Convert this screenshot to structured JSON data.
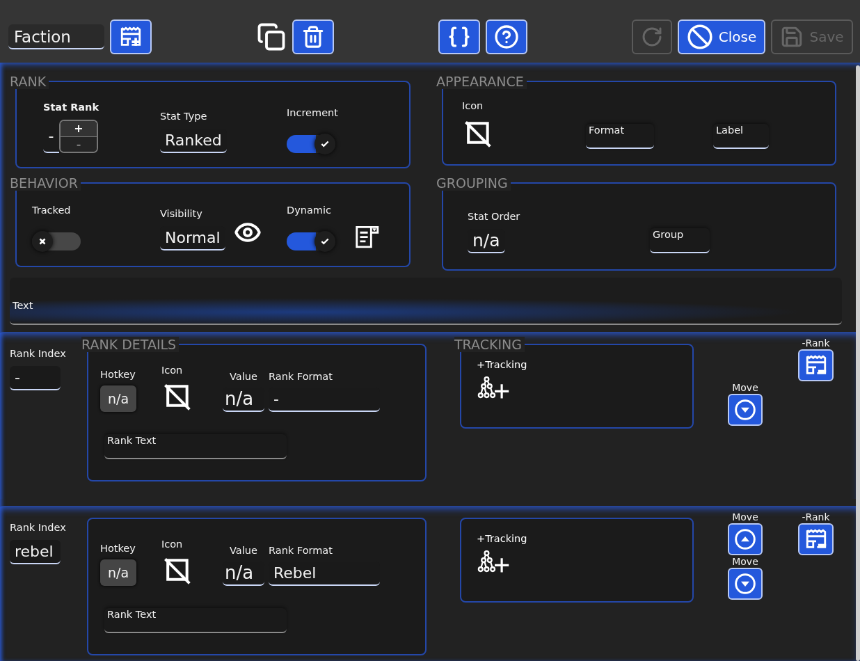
{
  "toolbar": {
    "title_field": {
      "value": "Faction"
    },
    "groups": [
      {
        "buttons": [
          {
            "kind": "add-rank",
            "disabled": false
          }
        ]
      },
      {
        "buttons": [
          {
            "kind": "copy",
            "disabled": false
          },
          {
            "kind": "delete",
            "disabled": false
          }
        ]
      },
      {
        "buttons": [
          {
            "kind": "json",
            "disabled": false
          },
          {
            "kind": "help",
            "disabled": false
          }
        ]
      },
      {
        "buttons": [
          {
            "kind": "reload",
            "disabled": true
          },
          {
            "kind": "close",
            "label": "Close",
            "disabled": false
          },
          {
            "kind": "save",
            "label": "Save",
            "disabled": true
          }
        ]
      }
    ]
  },
  "sections": [
    {
      "kind": "rank",
      "title": "RANK",
      "items": [
        {
          "kind": "stepper",
          "label": "Stat Rank",
          "value": "-",
          "increase": "+",
          "decrease": "-",
          "decrease_disabled": true
        },
        {
          "kind": "field",
          "label": "Stat Type",
          "value": "Ranked"
        },
        {
          "kind": "toggle",
          "label": "Increment",
          "on": true
        }
      ]
    },
    {
      "kind": "appearance",
      "title": "APPEARANCE",
      "items": [
        {
          "kind": "icon-picker",
          "label": "Icon"
        },
        {
          "kind": "floating-field",
          "label": "Format"
        },
        {
          "kind": "floating-field",
          "label": "Label"
        }
      ]
    },
    {
      "kind": "behavior",
      "title": "BEHAVIOR",
      "items": [
        {
          "kind": "toggle",
          "label": "Tracked",
          "on": false
        },
        {
          "kind": "field",
          "label": "Visibility",
          "value": "Normal"
        },
        {
          "kind": "eye-button"
        },
        {
          "kind": "toggle",
          "label": "Dynamic",
          "on": true
        },
        {
          "kind": "list-button"
        }
      ]
    },
    {
      "kind": "grouping",
      "title": "GROUPING",
      "items": [
        {
          "kind": "field",
          "label": "Stat Order",
          "value": "n/a"
        },
        {
          "kind": "floating-field",
          "label": "Group"
        }
      ]
    }
  ],
  "text_field": {
    "label": "Text"
  },
  "ranks": [
    {
      "index_label": "Rank Index",
      "index_value": "-",
      "details": {
        "title": "RANK DETAILS",
        "hotkey_label": "Hotkey",
        "hotkey": "n/a",
        "icon_label": "Icon",
        "value_label": "Value",
        "value": "n/a",
        "format_label": "Rank Format",
        "format": "-",
        "text_label": "Rank Text"
      },
      "tracking": {
        "title": "TRACKING",
        "label": "+Tracking"
      },
      "moves": [
        {
          "kind": "down",
          "label": "Move"
        }
      ],
      "remove_label": "-Rank"
    },
    {
      "index_label": "Rank Index",
      "index_value": "rebel",
      "details": {
        "hotkey_label": "Hotkey",
        "hotkey": "n/a",
        "icon_label": "Icon",
        "value_label": "Value",
        "value": "n/a",
        "format_label": "Rank Format",
        "format": "Rebel",
        "text_label": "Rank Text"
      },
      "tracking": {
        "label": "+Tracking"
      },
      "moves": [
        {
          "kind": "up",
          "label": "Move"
        },
        {
          "kind": "down",
          "label": "Move"
        }
      ],
      "remove_label": "-Rank"
    }
  ]
}
